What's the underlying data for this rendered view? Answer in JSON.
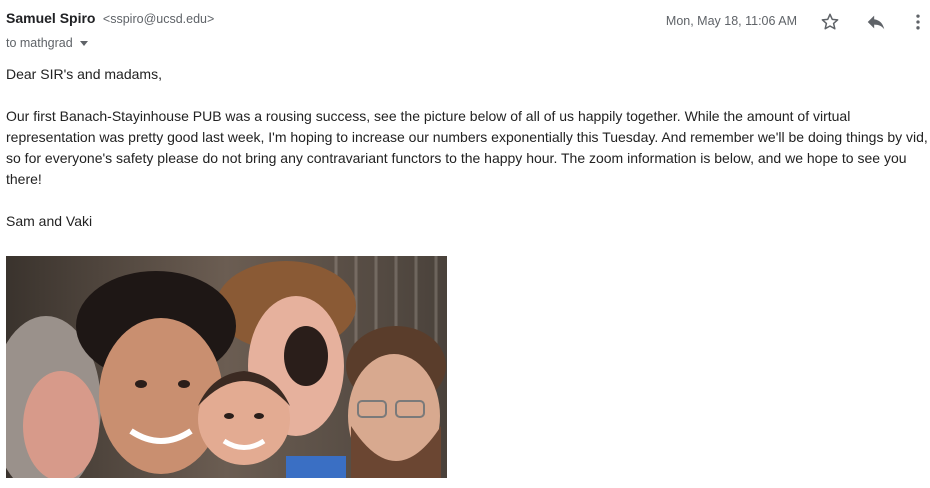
{
  "email": {
    "sender_name": "Samuel Spiro",
    "sender_email": "<sspiro@ucsd.edu>",
    "to_line": "to mathgrad",
    "date": "Mon, May 18, 11:06 AM",
    "greeting": "Dear SIR's and madams,",
    "paragraph": "Our first Banach-Stayinhouse PUB was a rousing success, see the picture below of all of us happily together.  While the amount of virtual representation was pretty good last week, I'm hoping to increase our numbers exponentially this Tuesday.  And remember we'll be doing things by vid, so for everyone's safety please do not bring any contravariant functors to the happy hour.  The zoom information is below, and we hope to see you there!",
    "signature": "Sam and Vaki"
  },
  "actions": {
    "star_icon": "star-outline-icon",
    "reply_icon": "reply-arrow-icon",
    "more_icon": "vertical-dots-icon"
  },
  "colors": {
    "text": "#222222",
    "secondary": "#5f6368",
    "icon": "#5f6368"
  }
}
